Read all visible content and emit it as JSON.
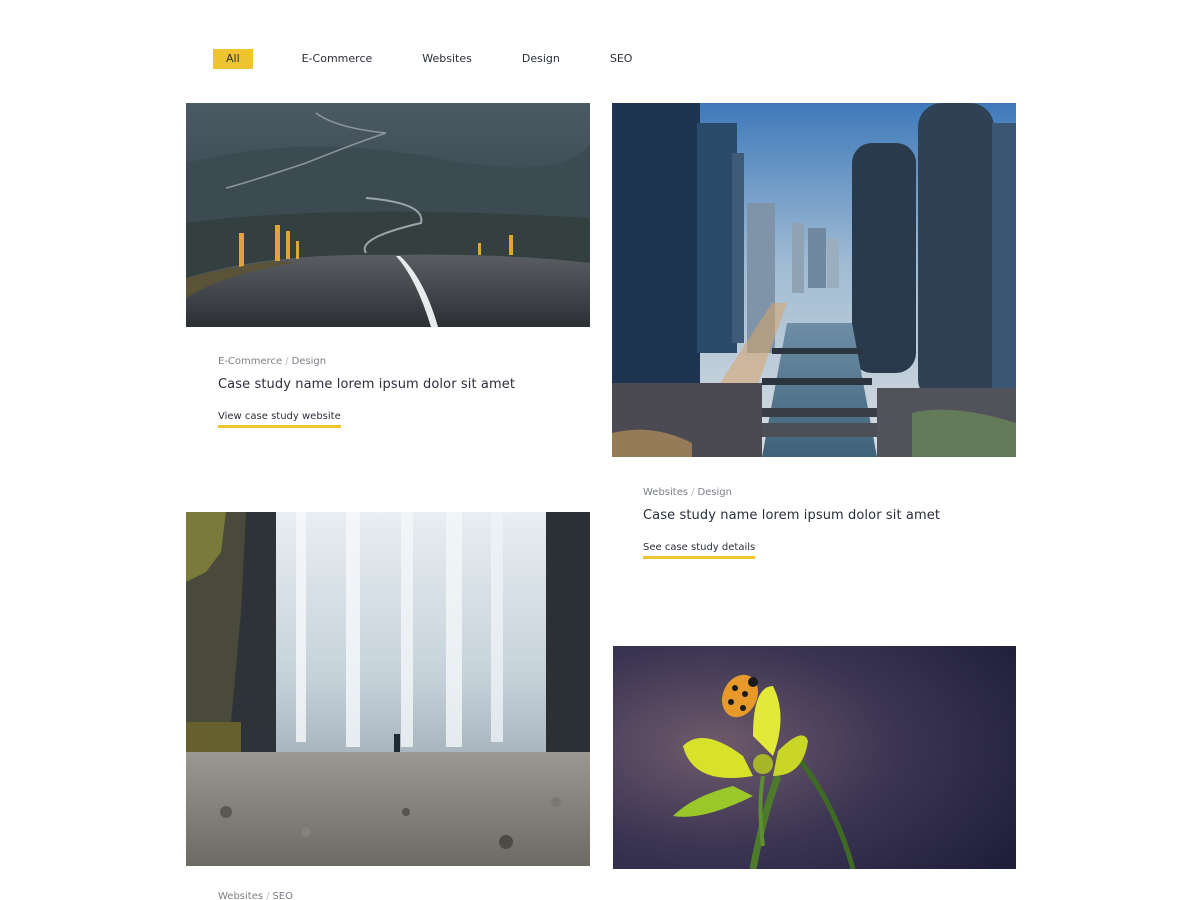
{
  "filters": [
    {
      "label": "All",
      "active": true
    },
    {
      "label": "E-Commerce",
      "active": false
    },
    {
      "label": "Websites",
      "active": false
    },
    {
      "label": "Design",
      "active": false
    },
    {
      "label": "SEO",
      "active": false
    }
  ],
  "cards": [
    {
      "image": "road-photo",
      "categories": [
        "E-Commerce",
        "Design"
      ],
      "separator": "/",
      "title": "Case study name lorem ipsum dolor sit amet",
      "link": "View case study website"
    },
    {
      "image": "city-river-photo",
      "categories": [
        "Websites",
        "Design"
      ],
      "separator": "/",
      "title": "Case study name lorem ipsum dolor sit amet",
      "link": "See case study details"
    },
    {
      "image": "waterfall-photo",
      "categories": [
        "Websites",
        "SEO"
      ],
      "separator": "/"
    },
    {
      "image": "ladybug-flower-photo"
    }
  ],
  "colors": {
    "accent": "#f0c42e",
    "text": "#2b2f3a",
    "muted": "#7b7f88"
  }
}
